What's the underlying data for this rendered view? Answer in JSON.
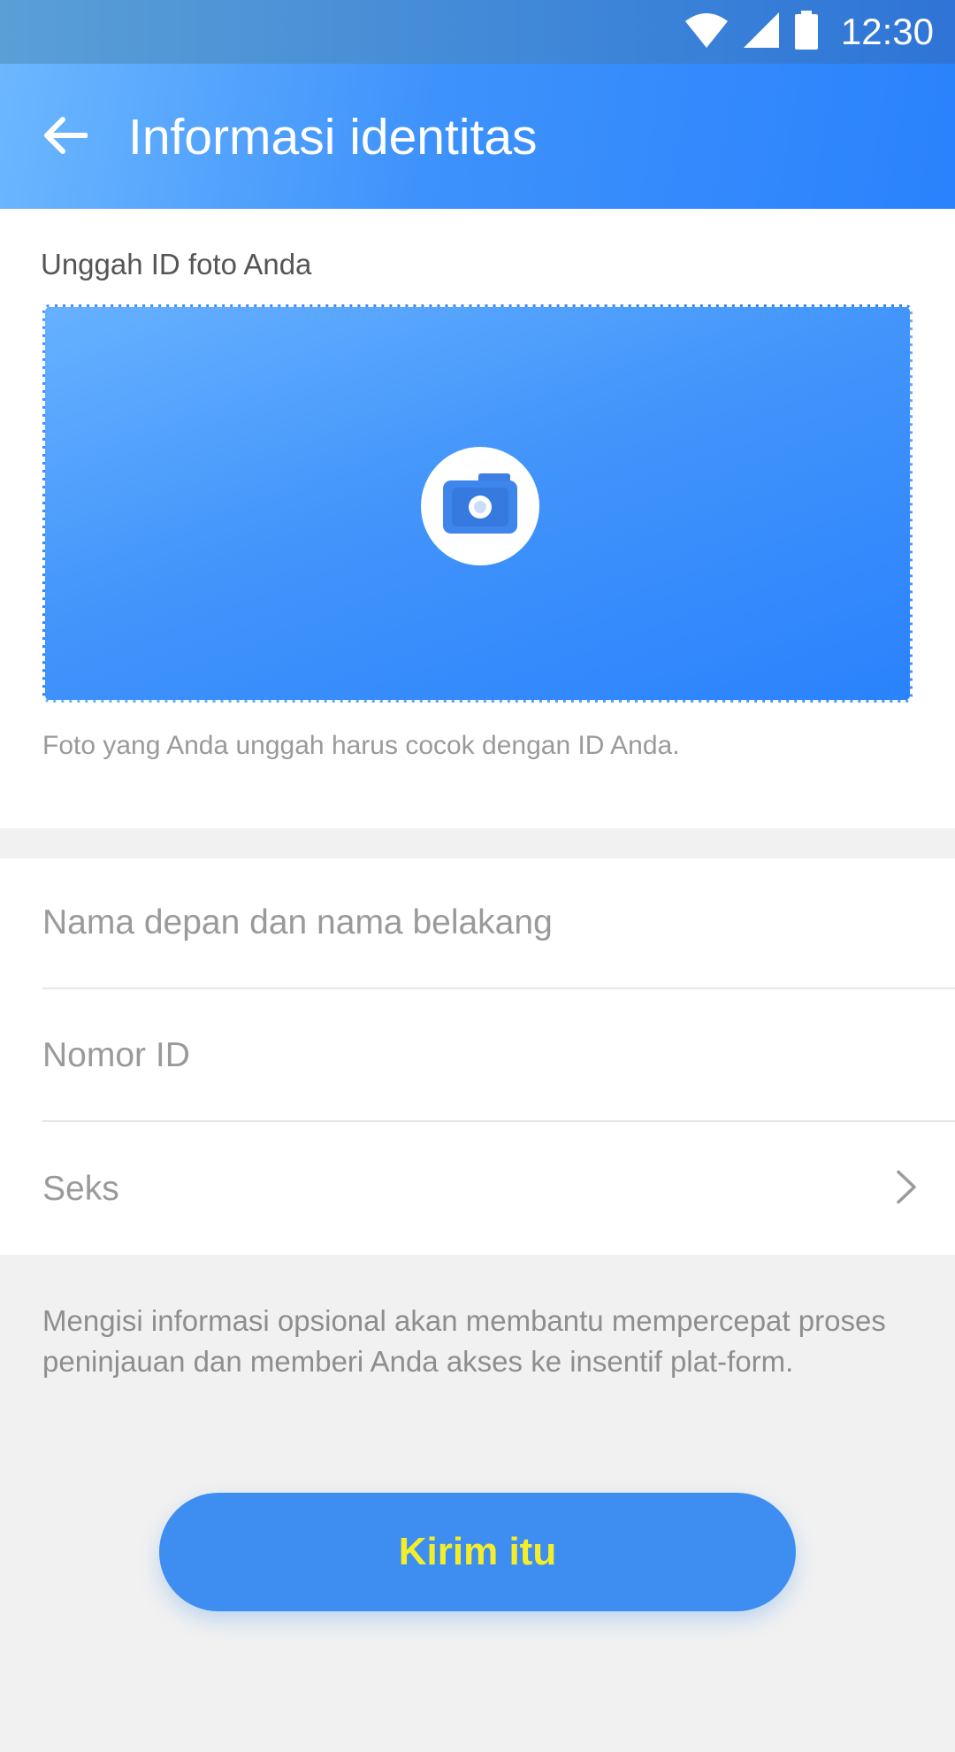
{
  "status_bar": {
    "time": "12:30",
    "icons": [
      "wifi-icon",
      "cellular-signal-icon",
      "battery-icon"
    ]
  },
  "app_bar": {
    "title": "Informasi identitas",
    "back_icon": "arrow-left-icon"
  },
  "upload": {
    "label": "Unggah ID foto Anda",
    "icon": "camera-icon",
    "hint": "Foto yang Anda unggah harus cocok dengan ID Anda."
  },
  "form": {
    "name_placeholder": "Nama depan dan nama belakang",
    "id_placeholder": "Nomor ID",
    "sex_label": "Seks",
    "sex_icon": "chevron-right-icon"
  },
  "info_text": "Mengisi informasi opsional akan membantu mempercepat proses peninjauan dan memberi Anda akses ke insentif plat-form.",
  "submit": {
    "label": "Kirim itu"
  },
  "colors": {
    "accent": "#3d8ef0",
    "header_start": "#6cb7ff",
    "header_end": "#2a82fc",
    "button_text": "#f4ee2a",
    "background": "#f1f1f1"
  }
}
